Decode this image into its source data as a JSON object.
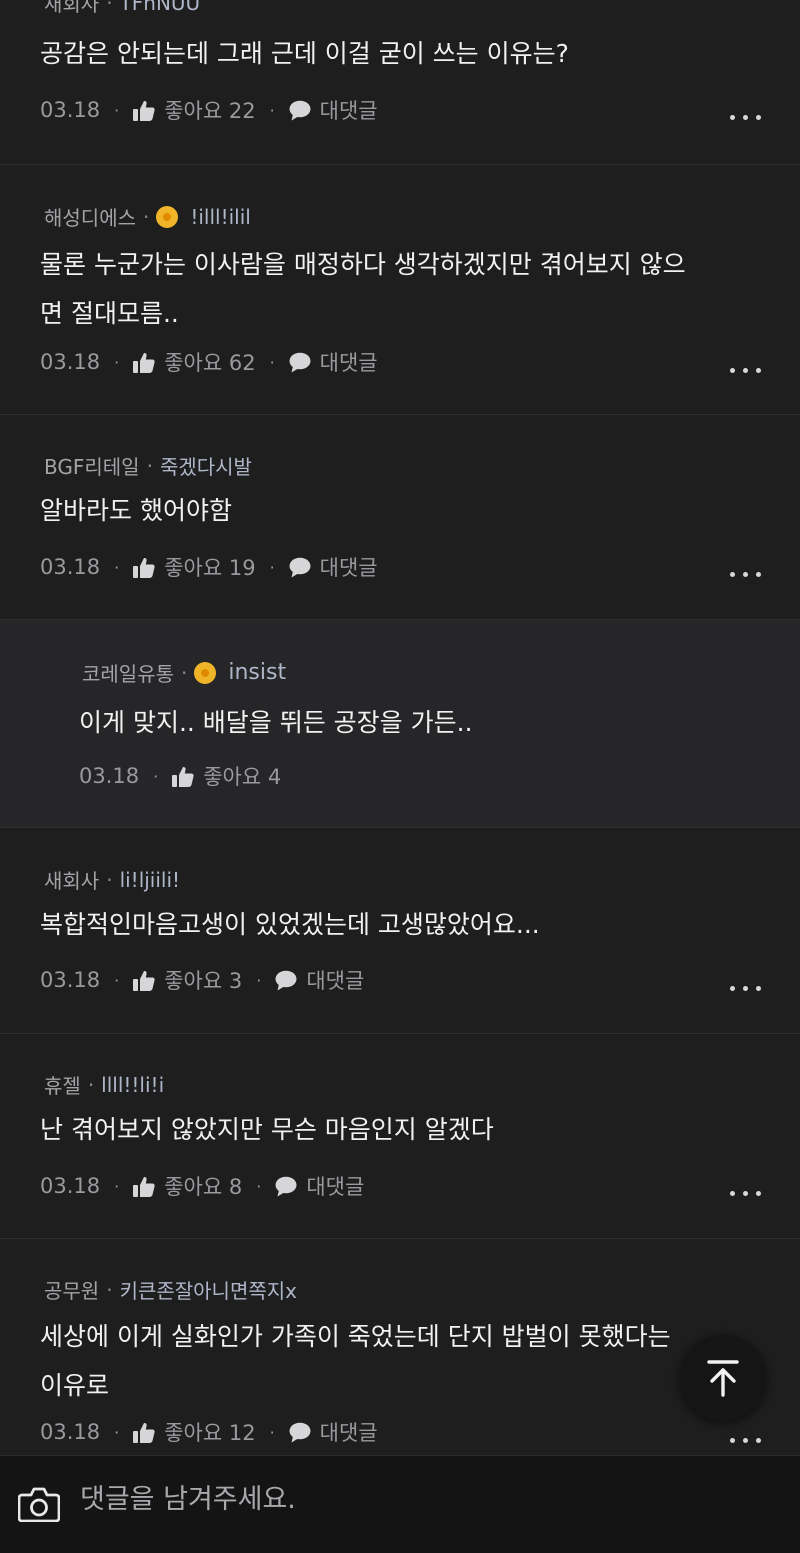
{
  "comments": [
    {
      "company": "새회사",
      "nick": "TFhNUU",
      "badge": false,
      "text": "공감은 안되는데 그래 근데 이걸 굳이 쓰는 이유는?",
      "date": "03.18",
      "like_label": "좋아요 22",
      "reply_label": "대댓글"
    },
    {
      "company": "해성디에스",
      "nick": "!illl!ilil",
      "badge": true,
      "text": "물론 누군가는 이사람을 매정하다 생각하겠지만 겪어보지 않으\n면 절대모름..",
      "date": "03.18",
      "like_label": "좋아요 62",
      "reply_label": "대댓글"
    },
    {
      "company": "BGF리테일",
      "nick": "죽겠다시발",
      "badge": false,
      "text": "알바라도 했어야함",
      "date": "03.18",
      "like_label": "좋아요 19",
      "reply_label": "대댓글"
    },
    {
      "company": "코레일유통",
      "nick": "insist",
      "badge": true,
      "text": "이게 맞지.. 배달을 뛰든 공장을 가든..",
      "date": "03.18",
      "like_label": "좋아요 4",
      "reply_label": ""
    },
    {
      "company": "새회사",
      "nick": "li!ljiili!",
      "badge": false,
      "text": "복합적인마음고생이 있었겠는데 고생많았어요...",
      "date": "03.18",
      "like_label": "좋아요 3",
      "reply_label": "대댓글"
    },
    {
      "company": "휴젤",
      "nick": "llll!!li!i",
      "badge": false,
      "text": "난 겪어보지 않았지만 무슨 마음인지 알겠다",
      "date": "03.18",
      "like_label": "좋아요 8",
      "reply_label": "대댓글"
    },
    {
      "company": "공무원",
      "nick": "키큰존잘아니면쪽지x",
      "badge": false,
      "text": "세상에 이게 실화인가 가족이 죽었는데 단지 밥벌이 못했다는\n이유로",
      "date": "03.18",
      "like_label": "좋아요 12",
      "reply_label": "대댓글"
    }
  ],
  "separator": "·",
  "composer": {
    "placeholder": "댓글을 남겨주세요."
  },
  "icons": {
    "like": "thumbs-up-icon",
    "reply": "speech-bubble-icon",
    "more": "more-dots-icon",
    "camera": "camera-icon",
    "top": "arrow-up-icon"
  }
}
